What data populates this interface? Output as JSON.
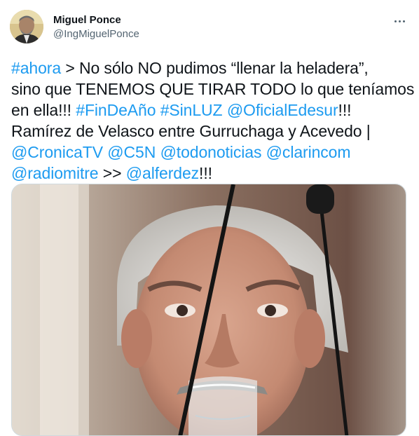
{
  "author": {
    "display_name": "Miguel Ponce",
    "handle": "@IngMiguelPonce"
  },
  "more_icon": "more-horizontal-icon",
  "tweet_lines": [
    [
      {
        "t": "#ahora",
        "link": true
      },
      {
        "t": " > No sólo NO pudimos “llenar la heladera”,",
        "link": false
      }
    ],
    [
      {
        "t": "sino que TENEMOS QUE TIRAR TODO lo que teníamos",
        "link": false
      }
    ],
    [
      {
        "t": "en ella!!! ",
        "link": false
      },
      {
        "t": "#FinDeAño",
        "link": true
      },
      {
        "t": " ",
        "link": false
      },
      {
        "t": "#SinLUZ",
        "link": true
      },
      {
        "t": " ",
        "link": false
      },
      {
        "t": "@OficialEdesur",
        "link": true
      },
      {
        "t": "!!!",
        "link": false
      }
    ],
    [
      {
        "t": "Ramírez de Velasco entre Gurruchaga y Acevedo |",
        "link": false
      }
    ],
    [
      {
        "t": "@CronicaTV",
        "link": true
      },
      {
        "t": " ",
        "link": false
      },
      {
        "t": "@C5N",
        "link": true
      },
      {
        "t": " ",
        "link": false
      },
      {
        "t": "@todonoticias",
        "link": true
      },
      {
        "t": " ",
        "link": false
      },
      {
        "t": "@clarincom",
        "link": true
      }
    ],
    [
      {
        "t": "@radiomitre",
        "link": true
      },
      {
        "t": " >>  ",
        "link": false
      },
      {
        "t": "@alferdez",
        "link": true
      },
      {
        "t": "!!!",
        "link": false
      }
    ]
  ],
  "colors": {
    "link": "#1d9bf0",
    "text": "#0f1419",
    "secondary": "#536471"
  }
}
